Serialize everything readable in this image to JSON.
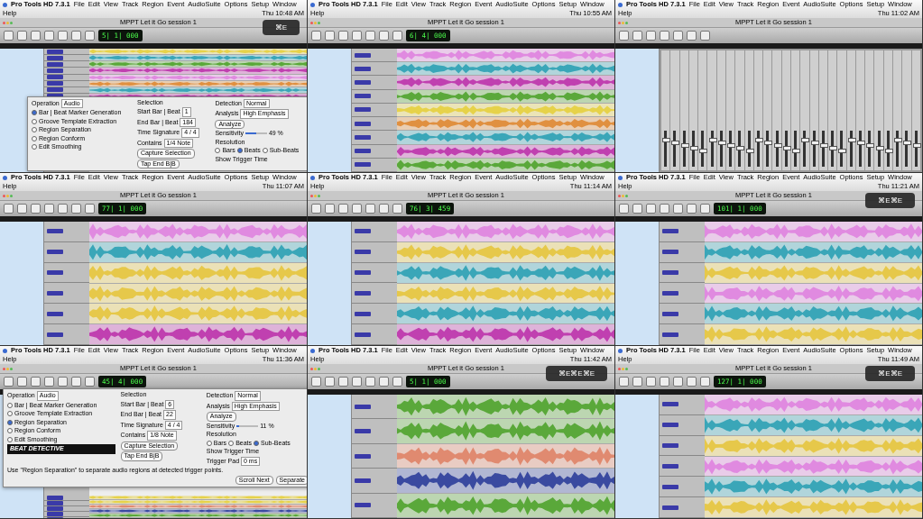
{
  "screens": [
    {
      "app": "Pro Tools HD 7.3.1",
      "menus": [
        "File",
        "Edit",
        "View",
        "Track",
        "Region",
        "Event",
        "AudioSuite",
        "Options",
        "Setup",
        "Window",
        "Help"
      ],
      "clock": "Thu 10:48 AM",
      "title": "MPPT Let it Go session 1",
      "counter": "5| 1| 000",
      "kind": "edit",
      "hud": "⌘E",
      "tracks": [
        {
          "color": "#e6d24a"
        },
        {
          "color": "#3aa6b8"
        },
        {
          "color": "#5aa83a"
        },
        {
          "color": "#c040b0"
        },
        {
          "color": "#e08ae0"
        },
        {
          "color": "#e09040"
        },
        {
          "color": "#3aa6b8"
        },
        {
          "color": "#c040b0"
        }
      ],
      "dialog": {
        "operation_label": "Operation",
        "operation": "Audio",
        "options": [
          {
            "label": "Bar | Beat Marker Generation",
            "selected": true
          },
          {
            "label": "Groove Template Extraction",
            "selected": false
          },
          {
            "label": "Region Separation",
            "selected": false
          },
          {
            "label": "Region Conform",
            "selected": false
          },
          {
            "label": "Edit Smoothing",
            "selected": false
          }
        ],
        "selection_title": "Selection",
        "fields": [
          {
            "label": "Start Bar | Beat",
            "value": "1"
          },
          {
            "label": "End Bar | Beat",
            "value": "184"
          },
          {
            "label": "Time Signature",
            "value": "4 / 4"
          },
          {
            "label": "Contains",
            "value": "1/4 Note"
          }
        ],
        "buttons": [
          "Capture Selection",
          "Tap End B|B"
        ],
        "detection_title": "Detection",
        "detection": "Normal",
        "analysis_label": "Analysis",
        "analysis": "High Emphasis",
        "analyze": "Analyze",
        "sensitivity_label": "Sensitivity",
        "sensitivity_value": "49 %",
        "level": 0.49,
        "resolution_label": "Resolution",
        "resolutions": [
          {
            "label": "Bars",
            "selected": false
          },
          {
            "label": "Beats",
            "selected": true
          },
          {
            "label": "Sub-Beats",
            "selected": false
          }
        ],
        "show_trigger": "Show Trigger Time"
      }
    },
    {
      "app": "Pro Tools HD 7.3.1",
      "menus": [
        "File",
        "Edit",
        "View",
        "Track",
        "Region",
        "Event",
        "AudioSuite",
        "Options",
        "Setup",
        "Window",
        "Help"
      ],
      "clock": "Thu 10:55 AM",
      "title": "MPPT Let it Go session 1",
      "counter": "6| 4| 000",
      "kind": "edit",
      "tracks": [
        {
          "color": "#e08ae0"
        },
        {
          "color": "#3aa6b8"
        },
        {
          "color": "#c040b0"
        },
        {
          "color": "#5aa83a"
        },
        {
          "color": "#e6d24a"
        },
        {
          "color": "#e09040"
        },
        {
          "color": "#3aa6b8"
        },
        {
          "color": "#c040b0"
        },
        {
          "color": "#5aa83a"
        }
      ]
    },
    {
      "app": "Pro Tools HD 7.3.1",
      "menus": [
        "File",
        "Edit",
        "View",
        "Track",
        "Region",
        "Event",
        "AudioSuite",
        "Options",
        "Setup",
        "Window",
        "Help"
      ],
      "clock": "Thu 11:02 AM",
      "title": "MPPT Let it Go session 1",
      "kind": "mix"
    },
    {
      "app": "Pro Tools HD 7.3.1",
      "menus": [
        "File",
        "Edit",
        "View",
        "Track",
        "Region",
        "Event",
        "AudioSuite",
        "Options",
        "Setup",
        "Window",
        "Help"
      ],
      "clock": "Thu 11:07 AM",
      "title": "MPPT Let it Go session 1",
      "counter": "77| 1| 000",
      "kind": "edit",
      "tracks": [
        {
          "color": "#e08ae0"
        },
        {
          "color": "#3aa6b8"
        },
        {
          "color": "#e6c84a"
        },
        {
          "color": "#e6c84a"
        },
        {
          "color": "#e6c84a"
        },
        {
          "color": "#c040b0"
        }
      ]
    },
    {
      "app": "Pro Tools HD 7.3.1",
      "menus": [
        "File",
        "Edit",
        "View",
        "Track",
        "Region",
        "Event",
        "AudioSuite",
        "Options",
        "Setup",
        "Window",
        "Help"
      ],
      "clock": "Thu 11:14 AM",
      "title": "MPPT Let it Go session 1",
      "counter": "76| 3| 459",
      "kind": "edit",
      "tracks": [
        {
          "color": "#e08ae0"
        },
        {
          "color": "#e6c84a"
        },
        {
          "color": "#3aa6b8"
        },
        {
          "color": "#e6c84a"
        },
        {
          "color": "#3aa6b8"
        },
        {
          "color": "#c040b0"
        }
      ]
    },
    {
      "app": "Pro Tools HD 7.3.1",
      "menus": [
        "File",
        "Edit",
        "View",
        "Track",
        "Region",
        "Event",
        "AudioSuite",
        "Options",
        "Setup",
        "Window",
        "Help"
      ],
      "clock": "Thu 11:21 AM",
      "title": "MPPT Let it Go session 1",
      "counter": "101| 1| 000",
      "kind": "edit",
      "hud": "⌘E⌘E",
      "tracks": [
        {
          "color": "#e08ae0"
        },
        {
          "color": "#3aa6b8"
        },
        {
          "color": "#e6c84a"
        },
        {
          "color": "#e08ae0"
        },
        {
          "color": "#3aa6b8"
        },
        {
          "color": "#e6c84a"
        }
      ]
    },
    {
      "app": "Pro Tools HD 7.3.1",
      "menus": [
        "File",
        "Edit",
        "View",
        "Track",
        "Region",
        "Event",
        "AudioSuite",
        "Options",
        "Setup",
        "Window",
        "Help"
      ],
      "clock": "Thu 11:36 AM",
      "title": "MPPT Let it Go session 1",
      "counter": "45| 4| 000",
      "kind": "edit",
      "tracks": [
        {
          "color": "#e6d24a"
        },
        {
          "color": "#e6d24a"
        },
        {
          "color": "#e08a70"
        },
        {
          "color": "#3a4aa0"
        },
        {
          "color": "#5aa83a"
        }
      ],
      "dialog": {
        "operation_label": "Operation",
        "operation": "Audio",
        "options": [
          {
            "label": "Bar | Beat Marker Generation",
            "selected": false
          },
          {
            "label": "Groove Template Extraction",
            "selected": false
          },
          {
            "label": "Region Separation",
            "selected": true
          },
          {
            "label": "Region Conform",
            "selected": false
          },
          {
            "label": "Edit Smoothing",
            "selected": false
          }
        ],
        "selection_title": "Selection",
        "fields": [
          {
            "label": "Start Bar | Beat",
            "value": "6"
          },
          {
            "label": "End Bar | Beat",
            "value": "22"
          },
          {
            "label": "Time Signature",
            "value": "4 / 4"
          },
          {
            "label": "Contains",
            "value": "1/8 Note"
          }
        ],
        "buttons": [
          "Capture Selection",
          "Tap End B|B"
        ],
        "detection_title": "Detection",
        "detection": "Normal",
        "analysis_label": "Analysis",
        "analysis": "High Emphasis",
        "analyze": "Analyze",
        "sensitivity_label": "Sensitivity",
        "sensitivity_value": "11 %",
        "level": 0.11,
        "resolution_label": "Resolution",
        "resolutions": [
          {
            "label": "Bars",
            "selected": false
          },
          {
            "label": "Beats",
            "selected": false
          },
          {
            "label": "Sub-Beats",
            "selected": true
          }
        ],
        "show_trigger": "Show Trigger Time",
        "trigger_pad_label": "Trigger Pad",
        "trigger_pad": "0 ms",
        "logo": "BEAT DETECTIVE",
        "hint": "Use \"Region Separation\" to separate audio regions at detected trigger points.",
        "footer_buttons": [
          "Scroll Next",
          "Separate"
        ]
      }
    },
    {
      "app": "Pro Tools HD 7.3.1",
      "menus": [
        "File",
        "Edit",
        "View",
        "Track",
        "Region",
        "Event",
        "AudioSuite",
        "Options",
        "Setup",
        "Window",
        "Help"
      ],
      "clock": "Thu 11:42 AM",
      "title": "MPPT Let it Go session 1",
      "counter": "5| 1| 000",
      "kind": "edit",
      "hud": "⌘E⌘E⌘E",
      "tracks": [
        {
          "color": "#5aa83a"
        },
        {
          "color": "#5aa83a"
        },
        {
          "color": "#e08a70"
        },
        {
          "color": "#3a4aa0"
        },
        {
          "color": "#5aa83a"
        }
      ]
    },
    {
      "app": "Pro Tools HD 7.3.1",
      "menus": [
        "File",
        "Edit",
        "View",
        "Track",
        "Region",
        "Event",
        "AudioSuite",
        "Options",
        "Setup",
        "Window",
        "Help"
      ],
      "clock": "Thu 11:49 AM",
      "title": "MPPT Let it Go session 1",
      "counter": "127| 1| 000",
      "kind": "edit",
      "hud": "⌘E⌘E",
      "tracks": [
        {
          "color": "#e08ae0"
        },
        {
          "color": "#3aa6b8"
        },
        {
          "color": "#e6c84a"
        },
        {
          "color": "#e08ae0"
        },
        {
          "color": "#3aa6b8"
        },
        {
          "color": "#e6c84a"
        }
      ]
    }
  ]
}
